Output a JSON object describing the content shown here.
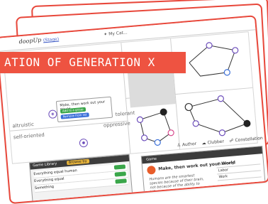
{
  "banner": {
    "text": "ATION OF GENERATION X"
  },
  "app": {
    "logo": "doopUp",
    "logo_tag": "(Stage)",
    "brand": "My Cat..."
  },
  "matrix": {
    "labels": {
      "altruistic": "altruistic",
      "self_oriented": "self-oriented",
      "tolerant": "tolerant",
      "oppressive": "oppressive"
    },
    "tooltip": {
      "title": "Make, then work out your World",
      "line1": "Add to a group",
      "line2": "Remove from list"
    }
  },
  "tabs": {
    "author": "Author",
    "clubber": "Clubber",
    "constellation": "Constellation"
  },
  "library": {
    "title": "Game Library",
    "filter": "Browse by",
    "rows": [
      "Everything equal human",
      "Everything equal",
      "Something"
    ]
  },
  "detail": {
    "tab": "Game",
    "title": "Make, then work out your World",
    "body": "Humans are the smartest species because of their brain, not because of the ability to kill.",
    "table": [
      "Economy",
      "Labor",
      "Work"
    ]
  },
  "colors": {
    "accent": "#ee5341",
    "border": "#e8473a",
    "node": "#6c4dbb"
  }
}
